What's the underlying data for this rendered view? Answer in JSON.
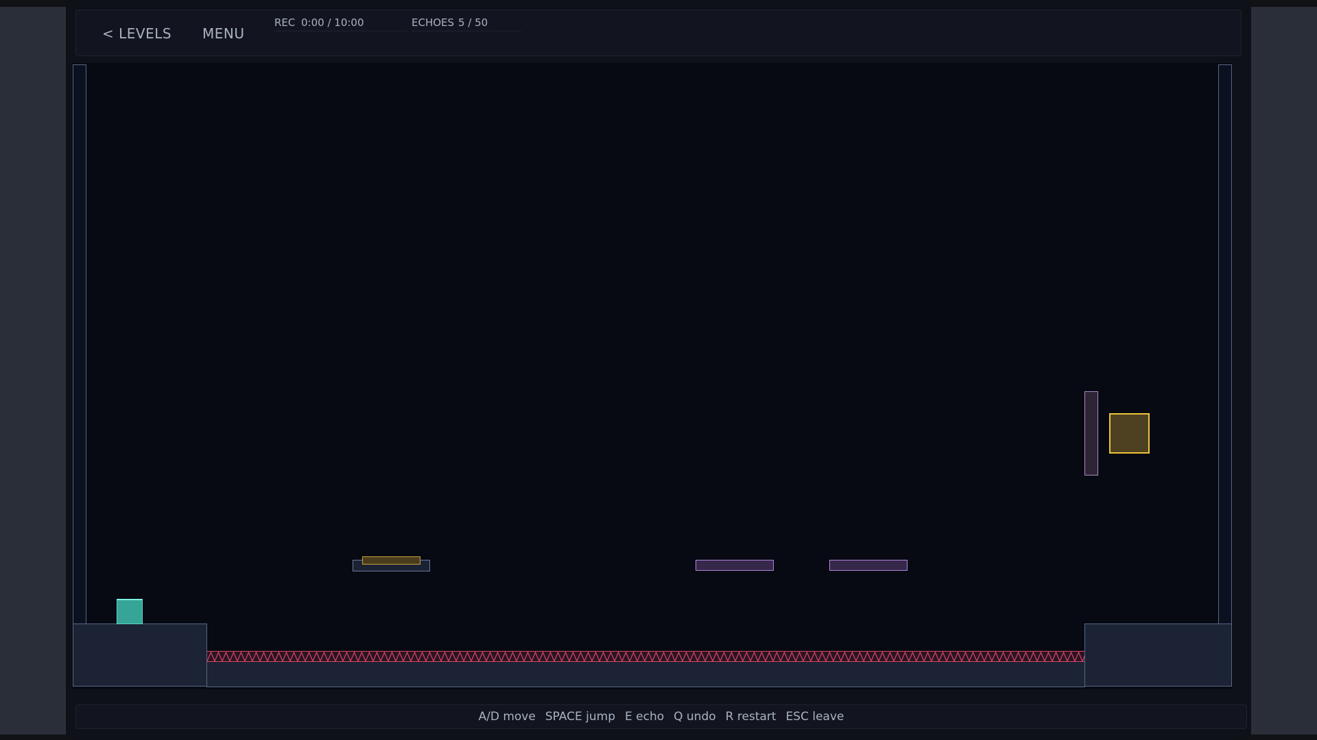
{
  "hud": {
    "back_label": "< LEVELS",
    "menu_label": "MENU",
    "rec_label": "REC",
    "rec_value": "0:00 / 10:00",
    "echoes_label": "ECHOES",
    "echoes_value": "5 / 50",
    "rec_progress": 0,
    "echoes_progress": 0.1
  },
  "controls": [
    "A/D move",
    "SPACE jump",
    "E echo",
    "Q undo",
    "R restart",
    "ESC leave"
  ],
  "colors": {
    "background": "#070a12",
    "player": "#36a497",
    "goal": "#f0c53a",
    "hazard": "#d84766",
    "pressure_plate": "#c9a23c",
    "echo_platform": "#b386e0"
  }
}
